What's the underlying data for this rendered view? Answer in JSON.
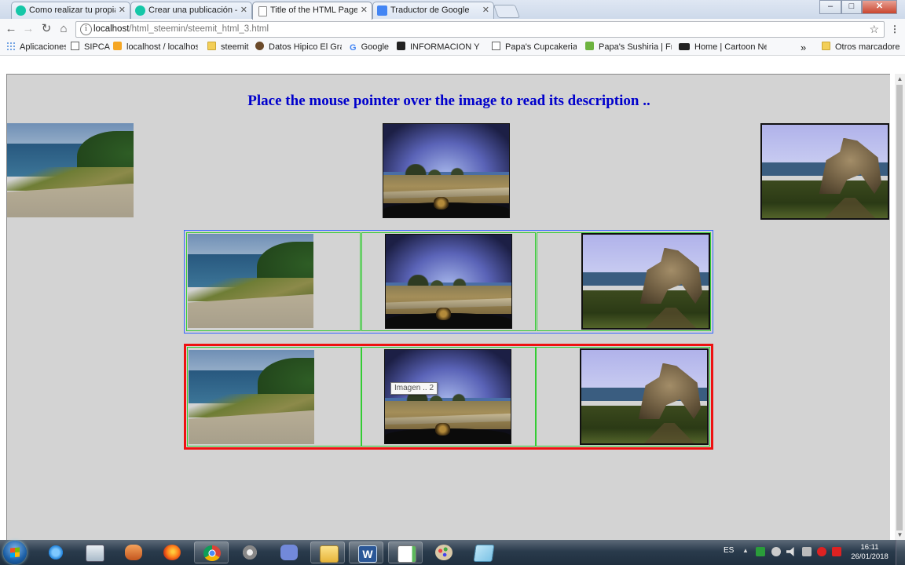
{
  "browser": {
    "tabs": [
      {
        "title": "Como realizar tu propia p",
        "active": false,
        "icon": "steemit-icon",
        "color": "#15c7a8"
      },
      {
        "title": "Crear una publicación — ",
        "active": false,
        "icon": "steemit-icon",
        "color": "#15c7a8"
      },
      {
        "title": "Title of the HTML Page",
        "active": true,
        "icon": "page-icon",
        "color": "#ffffff"
      },
      {
        "title": "Traductor de Google",
        "active": false,
        "icon": "google-translate-icon",
        "color": "#4285f4"
      }
    ],
    "address": {
      "host": "localhost",
      "path": "/html_steemin/steemit_html_3.html"
    },
    "bookmarks": [
      {
        "label": "Aplicaciones",
        "icon": "apps-icon"
      },
      {
        "label": "SIPCA",
        "icon": "page-icon"
      },
      {
        "label": "localhost / localhost |",
        "icon": "phpmyadmin-icon"
      },
      {
        "label": "steemit",
        "icon": "folder-icon"
      },
      {
        "label": "Datos Hipico El Gran",
        "icon": "horse-icon"
      },
      {
        "label": "Google",
        "icon": "google-icon"
      },
      {
        "label": "INFORMACION Y PRO",
        "icon": "x-icon"
      },
      {
        "label": "Papa's Cupcakeria | F",
        "icon": "page-icon"
      },
      {
        "label": "Papa's Sushiria | Free",
        "icon": "green-icon"
      },
      {
        "label": "Home | Cartoon Netw",
        "icon": "cn-icon"
      },
      {
        "label": "Otros marcadores",
        "icon": "folder-icon"
      }
    ],
    "bookmarks_overflow": "»",
    "window_controls": {
      "minimize": "‒",
      "maximize": "□",
      "close": "✕"
    }
  },
  "page": {
    "heading": "Place the mouse pointer over the image to read its description ..",
    "tooltip": "Imagen .. 2",
    "background": "#d3d3d3",
    "heading_color": "#0000cc",
    "table1_border": "#3366ff",
    "table2_border": "#ee1111",
    "cell_border": "#33cc33"
  },
  "taskbar": {
    "apps": [
      "ie-icon",
      "file-manager-icon",
      "bitnami-icon",
      "firefox-icon",
      "chrome-icon",
      "settings-icon",
      "discord-icon",
      "explorer-icon",
      "word-icon",
      "notepad-icon",
      "paint-icon",
      "notes-icon"
    ],
    "language": "ES",
    "time": "16:11",
    "date": "26/01/2018"
  }
}
